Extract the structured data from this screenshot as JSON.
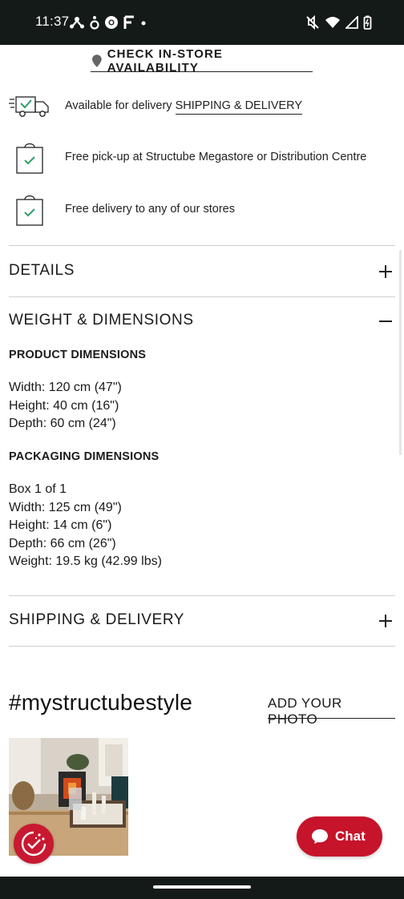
{
  "status_bar": {
    "time": "11:37"
  },
  "store": {
    "check_availability": "CHECK IN-STORE AVAILABILITY"
  },
  "availability": {
    "delivery_text": "Available for delivery",
    "delivery_link": "SHIPPING & DELIVERY",
    "pickup_text": "Free pick-up at Structube Megastore or Distribution Centre",
    "store_delivery_text": "Free delivery to any of our stores"
  },
  "sections": {
    "details_title": "DETAILS",
    "weight_title": "WEIGHT & DIMENSIONS",
    "shipping_title": "SHIPPING & DELIVERY"
  },
  "product_dimensions": {
    "heading": "PRODUCT DIMENSIONS",
    "lines": [
      "Width: 120 cm (47\")",
      "Height: 40 cm (16\")",
      "Depth: 60 cm (24\")"
    ]
  },
  "packaging_dimensions": {
    "heading": "PACKAGING DIMENSIONS",
    "lines": [
      "Box 1 of 1",
      "Width: 125 cm (49\")",
      "Height: 14 cm (6\")",
      "Depth: 66 cm (26\")",
      "Weight: 19.5 kg (42.99 lbs)"
    ]
  },
  "social": {
    "hashtag": "#mystructubestyle",
    "add_photo": "ADD YOUR PHOTO"
  },
  "chat": {
    "label": "Chat"
  },
  "colors": {
    "accent_red": "#c6142a",
    "check_green": "#2e9e6b",
    "system_bar": "#141a17"
  }
}
